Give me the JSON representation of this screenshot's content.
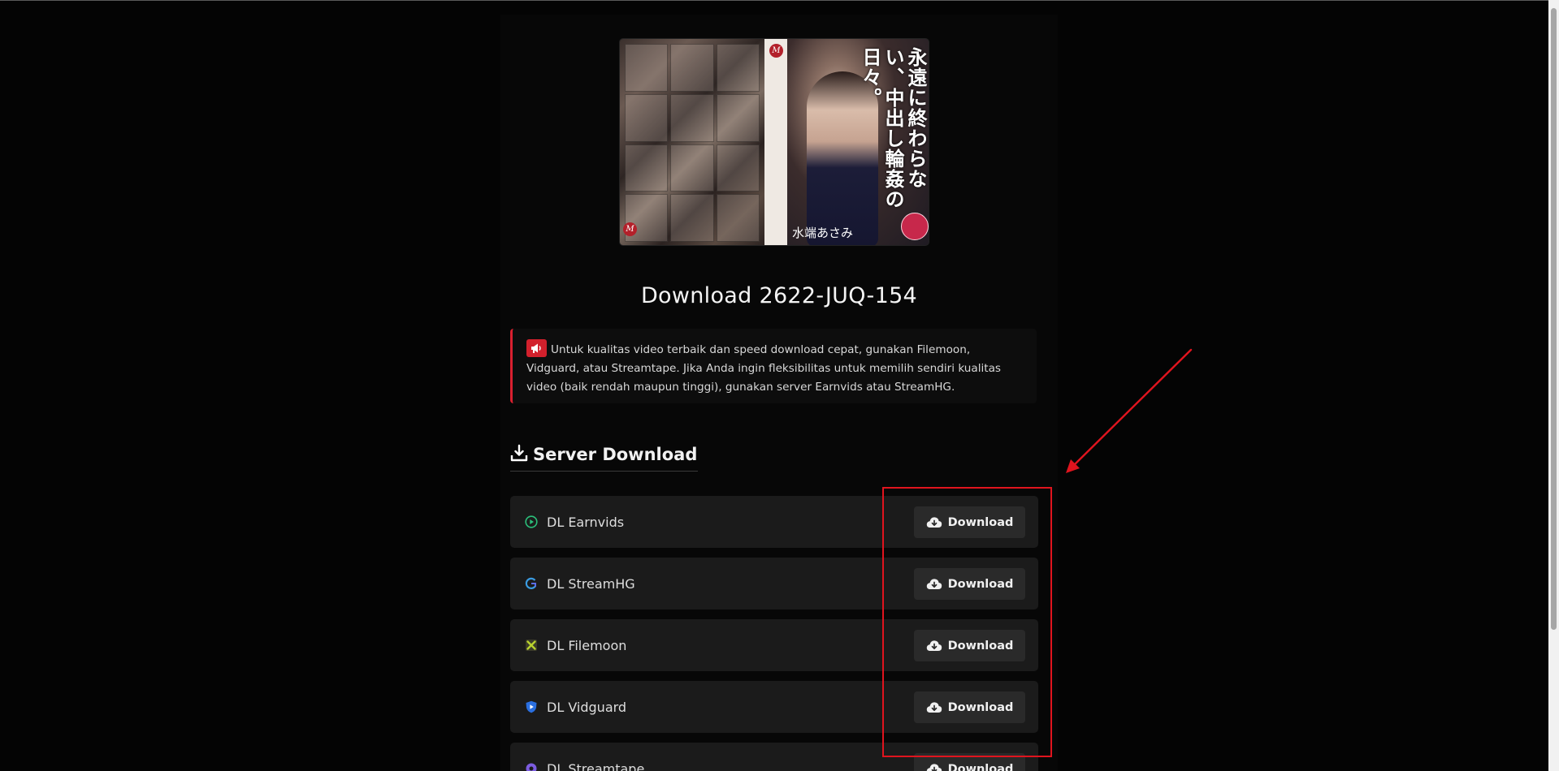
{
  "cover": {
    "vertical_title": "永遠に終わらない、中出し輪姦の日々。",
    "actress_name": "水端あさみ",
    "logo_mark": "M"
  },
  "page": {
    "title": "Download 2622-JUQ-154"
  },
  "notice": {
    "text": "Untuk kualitas video terbaik dan speed download cepat, gunakan Filemoon, Vidguard, atau Streamtape. Jika Anda ingin fleksibilitas untuk memilih sendiri kualitas video (baik rendah maupun tinggi), gunakan server Earnvids atau StreamHG.",
    "icon": "megaphone-icon",
    "accent_color": "#d9202f"
  },
  "section": {
    "title": "Server Download",
    "icon": "download-icon"
  },
  "servers": [
    {
      "name": "DL Earnvids",
      "button": "Download",
      "icon": "play-circle-icon",
      "icon_color": "#2bbf7a"
    },
    {
      "name": "DL StreamHG",
      "button": "Download",
      "icon": "streamhg-logo-icon",
      "icon_color": "#3a9be0"
    },
    {
      "name": "DL Filemoon",
      "button": "Download",
      "icon": "filemoon-logo-icon",
      "icon_color": "#b8d22e"
    },
    {
      "name": "DL Vidguard",
      "button": "Download",
      "icon": "shield-play-icon",
      "icon_color": "#2a6fe0"
    },
    {
      "name": "DL Streamtape",
      "button": "Download",
      "icon": "streamtape-logo-icon",
      "icon_color": "#7c5ce0"
    }
  ],
  "annotation_color": "#e0141e"
}
